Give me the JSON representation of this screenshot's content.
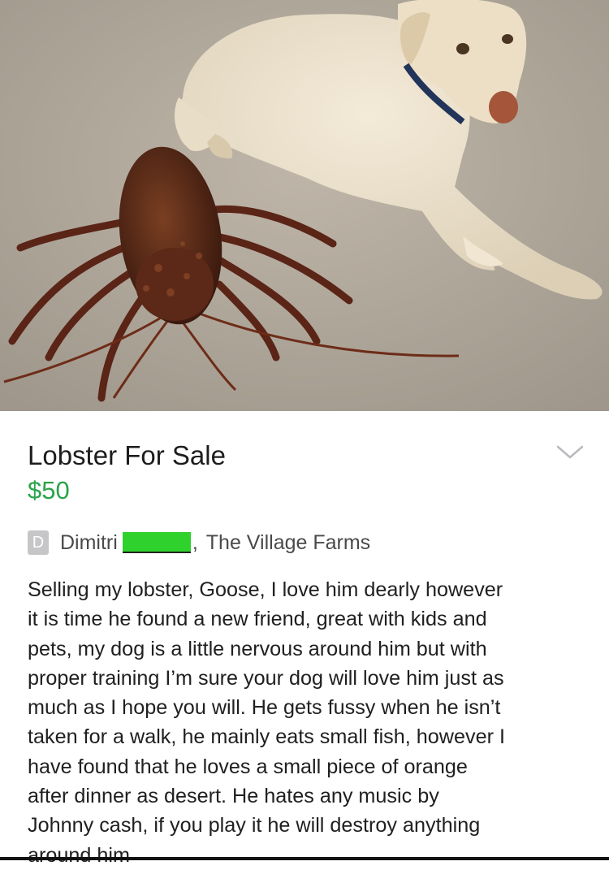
{
  "listing": {
    "title": "Lobster For Sale",
    "price": "$50",
    "price_color": "#2aa44a",
    "expand_icon": "chevron-down-icon"
  },
  "seller": {
    "avatar_initial": "D",
    "name": "Dimitri",
    "separator": ",",
    "location": "The Village Farms",
    "redaction_color": "#2fd12c"
  },
  "description_lines": [
    "Selling my lobster, Goose, I love him dearly however",
    "it is time he found a new friend, great with kids and",
    "pets, my dog is a little nervous around him but with",
    "proper training I’m sure your dog will love him just as",
    "much as I hope you will. He gets fussy when he isn’t",
    "taken for a walk, he mainly eats small fish, however I",
    "have found that he loves a small piece of orange",
    "after dinner as desert. He hates any music by",
    "Johnny cash, if you play it he will destroy anything",
    "around him"
  ]
}
